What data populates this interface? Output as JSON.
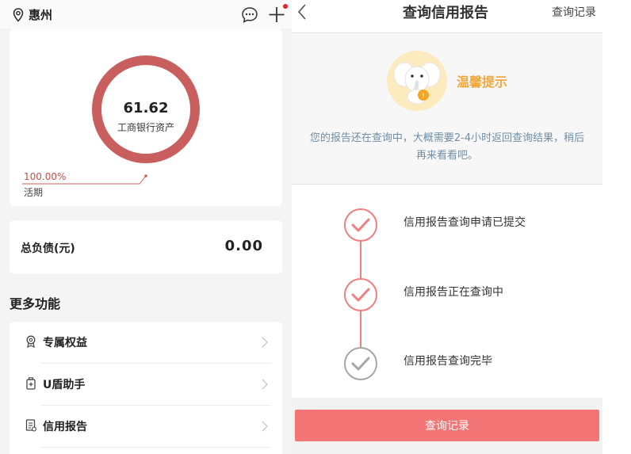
{
  "left": {
    "location": "惠州",
    "asset": {
      "value": "61.62",
      "label": "工商银行资产",
      "percent": "100.00%",
      "category": "活期",
      "ring_color": "#c85f5e"
    },
    "debt": {
      "label": "总负债(元)",
      "value": "0.00"
    },
    "more_title": "更多功能",
    "functions": [
      {
        "label": "专属权益",
        "icon": "badge-icon"
      },
      {
        "label": "U盾助手",
        "icon": "usb-key-icon"
      },
      {
        "label": "信用报告",
        "icon": "report-icon"
      }
    ]
  },
  "right": {
    "title": "查询信用报告",
    "record_link": "查询记录",
    "tips_title": "温馨提示",
    "tips_text": "您的报告还在查询中，大概需要2-4小时返回查询结果，稍后再来看看吧。",
    "steps": [
      {
        "label": "信用报告查询申请已提交",
        "status": "done"
      },
      {
        "label": "信用报告正在查询中",
        "status": "done"
      },
      {
        "label": "信用报告查询完毕",
        "status": "pending"
      }
    ],
    "button_label": "查询记录",
    "accent": "#f47576",
    "tips_color": "#f0a73c"
  }
}
